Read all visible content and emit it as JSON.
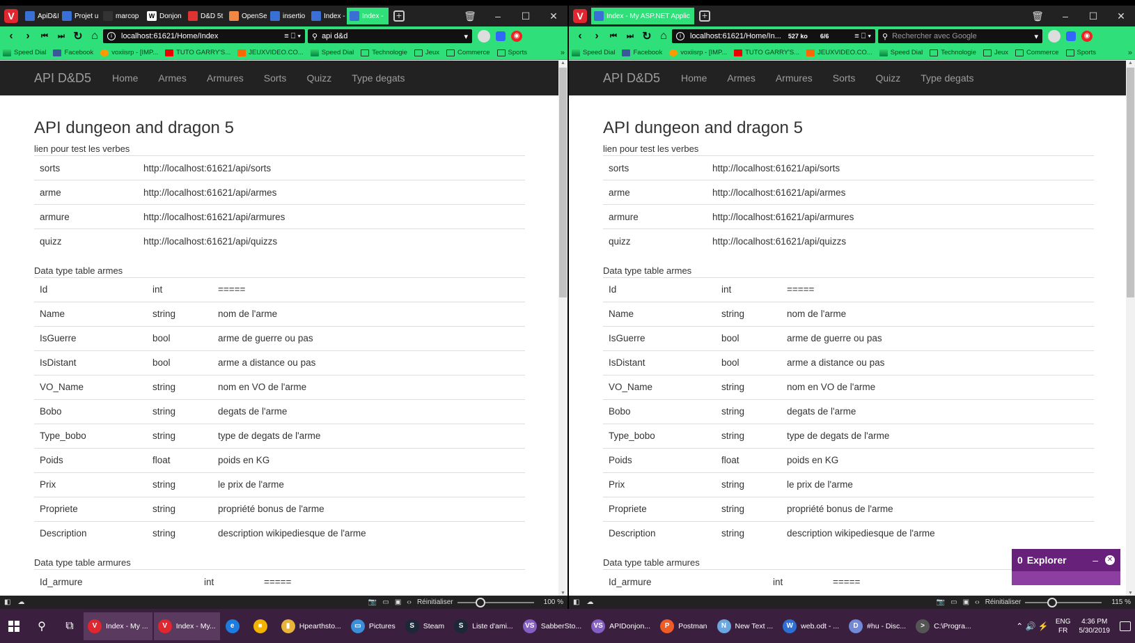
{
  "colors": {
    "accent": "#2fe07a",
    "navbar": "#222222",
    "explorer": "#68217a",
    "taskbar": "#3a1f3f"
  },
  "left_window": {
    "tabs": [
      {
        "label": "ApiD&D",
        "icon": "file-icon"
      },
      {
        "label": "Projet u",
        "icon": "file-icon"
      },
      {
        "label": "marcop",
        "icon": "github-icon"
      },
      {
        "label": "Donjon",
        "icon": "wiki-icon"
      },
      {
        "label": "D&D 5t",
        "icon": "dnd-icon"
      },
      {
        "label": "OpenSe",
        "icon": "open5e-icon"
      },
      {
        "label": "insertio",
        "icon": "file-icon"
      },
      {
        "label": "Index -",
        "icon": "page-icon"
      },
      {
        "label": "Index -",
        "icon": "page-icon"
      }
    ],
    "url": "localhost:61621/Home/Index",
    "search_value": "api d&d",
    "zoom": "100 %",
    "zoom_level": 1.0
  },
  "right_window": {
    "tabs": [
      {
        "label": "Index - My ASP.NET Applic",
        "icon": "page-icon"
      }
    ],
    "url": "localhost:61621/Home/In...",
    "page_size": "527 ko",
    "resources": "6/6",
    "search_placeholder": "Rechercher avec Google",
    "zoom": "115 %",
    "zoom_level": 1.15
  },
  "bookmarks": [
    "Speed Dial",
    "Facebook",
    "voxiisrp - [IMP...",
    "TUTO GARRY'S...",
    "JEUXVIDEO.CO...",
    "Speed Dial",
    "Technologie",
    "Jeux",
    "Commerce",
    "Sports"
  ],
  "statusbar": {
    "reset_label": "Réinitialiser"
  },
  "site": {
    "brand": "API D&D5",
    "nav": [
      "Home",
      "Armes",
      "Armures",
      "Sorts",
      "Quizz",
      "Type degats"
    ],
    "title": "API dungeon and dragon 5",
    "verbs_caption": "lien pour test les verbes",
    "verbs": [
      [
        "sorts",
        "http://localhost:61621/api/sorts"
      ],
      [
        "arme",
        "http://localhost:61621/api/armes"
      ],
      [
        "armure",
        "http://localhost:61621/api/armures"
      ],
      [
        "quizz",
        "http://localhost:61621/api/quizzs"
      ]
    ],
    "armes_caption": "Data type table armes",
    "armes": [
      [
        "Id",
        "int",
        "====="
      ],
      [
        "Name",
        "string",
        "nom de l'arme"
      ],
      [
        "IsGuerre",
        "bool",
        "arme de guerre ou pas"
      ],
      [
        "IsDistant",
        "bool",
        "arme a distance ou pas"
      ],
      [
        "VO_Name",
        "string",
        "nom en VO de l'arme"
      ],
      [
        "Bobo",
        "string",
        "degats de l'arme"
      ],
      [
        "Type_bobo",
        "string",
        "type de degats de l'arme"
      ],
      [
        "Poids",
        "float",
        "poids en KG"
      ],
      [
        "Prix",
        "string",
        "le prix de l'arme"
      ],
      [
        "Propriete",
        "string",
        "propriété bonus de l'arme"
      ],
      [
        "Description",
        "string",
        "description wikipediesque de l'arme"
      ]
    ],
    "armures_caption": "Data type table armures",
    "armures": [
      [
        "Id_armure",
        "int",
        "====="
      ]
    ]
  },
  "explorer": {
    "count": "0",
    "label": "Explorer"
  },
  "taskbar": {
    "apps": [
      {
        "label": "Index - My ...",
        "color": "#e0262f",
        "glyph": "V",
        "active": true
      },
      {
        "label": "Index - My...",
        "color": "#e0262f",
        "glyph": "V",
        "active": true
      },
      {
        "label": "",
        "color": "#1e7be0",
        "glyph": "e",
        "active": false
      },
      {
        "label": "",
        "color": "#f2b400",
        "glyph": "■",
        "active": false
      },
      {
        "label": "Hpearthsto...",
        "color": "#e8b43a",
        "glyph": "▮",
        "active": false
      },
      {
        "label": "Pictures",
        "color": "#3a8fd9",
        "glyph": "▭",
        "active": false
      },
      {
        "label": "Steam",
        "color": "#1b2838",
        "glyph": "S",
        "active": false
      },
      {
        "label": "Liste d'ami...",
        "color": "#1b2838",
        "glyph": "S",
        "active": false
      },
      {
        "label": "SabberSto...",
        "color": "#865fc5",
        "glyph": "VS",
        "active": false
      },
      {
        "label": "APIDonjon...",
        "color": "#865fc5",
        "glyph": "VS",
        "active": false
      },
      {
        "label": "Postman",
        "color": "#ef5b25",
        "glyph": "P",
        "active": false
      },
      {
        "label": "New Text ...",
        "color": "#6aa7e0",
        "glyph": "N",
        "active": false
      },
      {
        "label": "web.odt - ...",
        "color": "#2e6fd6",
        "glyph": "W",
        "active": false
      },
      {
        "label": "#hu - Disc...",
        "color": "#7289da",
        "glyph": "D",
        "active": false
      },
      {
        "label": "C:\\Progra...",
        "color": "#555555",
        "glyph": ">",
        "active": false
      }
    ],
    "lang": "ENG",
    "region": "FR",
    "time": "4:36 PM",
    "date": "5/30/2019"
  }
}
